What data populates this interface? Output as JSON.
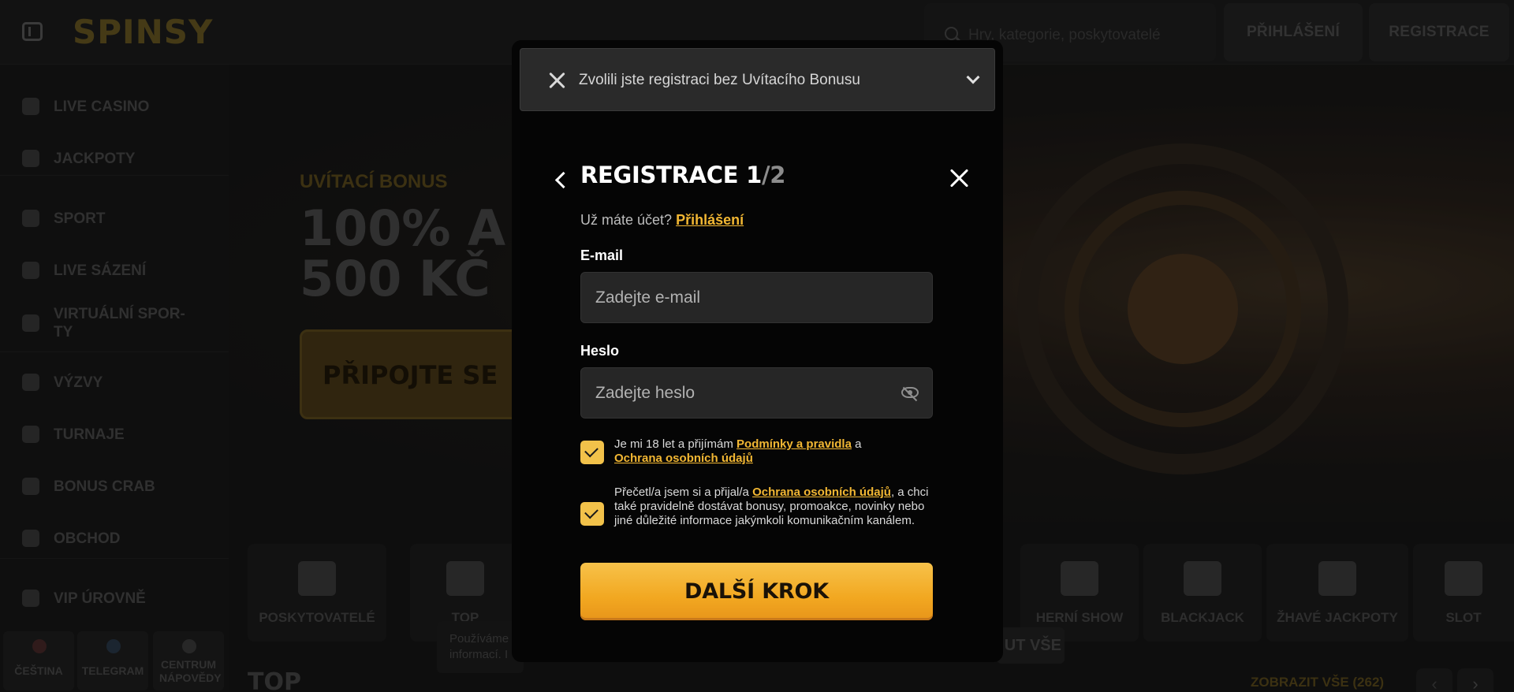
{
  "header": {
    "logo": "SPINSY",
    "search_placeholder": "Hry, kategorie, poskytovatelé",
    "login_label": "PŘIHLÁŠENÍ",
    "register_label": "REGISTRACE"
  },
  "sidebar": {
    "items": [
      {
        "label": "LIVE CASINO",
        "icon": "live-casino-icon"
      },
      {
        "label": "JACKPOTY",
        "icon": "clover-icon"
      },
      {
        "label": "SPORT",
        "icon": "sport-icon"
      },
      {
        "label": "LIVE SÁZENÍ",
        "icon": "live-betting-icon"
      },
      {
        "label": "VIRTUÁLNÍ SPOR-\nTY",
        "icon": "virtual-sports-icon"
      },
      {
        "label": "VÝZVY",
        "icon": "challenges-icon"
      },
      {
        "label": "TURNAJE",
        "icon": "trophy-icon"
      },
      {
        "label": "BONUS CRAB",
        "icon": "crab-icon"
      },
      {
        "label": "OBCHOD",
        "icon": "shop-icon"
      },
      {
        "label": "VIP ÚROVNĚ",
        "icon": "diamond-icon"
      }
    ],
    "footer": [
      {
        "label": "ČEŠTINA",
        "icon": "flag-icon"
      },
      {
        "label": "TELEGRAM",
        "icon": "telegram-icon"
      },
      {
        "label": "CENTRUM NÁPOVĚDY",
        "icon": "help-icon"
      }
    ]
  },
  "hero": {
    "subtitle": "UVÍTACÍ BONUS",
    "title_line1": "100% A",
    "title_line2": "500 KČ",
    "cta": "PŘIPOJTE SE"
  },
  "categories": [
    {
      "label": "POSKYTOVATELÉ",
      "icon": "book-icon"
    },
    {
      "label": "TOP",
      "icon": "crown-icon"
    },
    {
      "label": "HERNÍ SHOW",
      "icon": "wheel-icon"
    },
    {
      "label": "BLACKJACK",
      "icon": "card-icon"
    },
    {
      "label": "ŽHAVÉ JACKPOTY",
      "icon": "flame-icon"
    },
    {
      "label": "SLOT",
      "icon": "slot-icon"
    }
  ],
  "top_section": {
    "heading": "TOP",
    "show_all": "ZOBRAZIT VŠE (262)"
  },
  "cookie": {
    "text_line1": "Používáme",
    "text_line2": "informací. I",
    "button": "UT VŠE"
  },
  "modal": {
    "bonus_bar_text": "Zvolili jste registraci bez Uvítacího Bonusu",
    "title_main": "REGISTRACE 1",
    "title_suffix": "/2",
    "have_account": "Už máte účet?",
    "login_link": "Přihlášení",
    "email_label": "E-mail",
    "email_placeholder": "Zadejte e-mail",
    "password_label": "Heslo",
    "password_placeholder": "Zadejte heslo",
    "consent1_pre": "Je mi 18 let a přijímám ",
    "consent1_link1": "Podmínky a pravidla",
    "consent1_mid": " a ",
    "consent1_link2": "Ochrana osobních údajů",
    "consent2_pre": "Přečetl/a jsem si a přijal/a ",
    "consent2_link": "Ochrana osobních údajů",
    "consent2_post": ", a chci také pravidelně dostávat bonusy, promoakce, novinky nebo jiné důležité informace jakýmkoli komunikačním kanálem.",
    "consent1_checked": true,
    "consent2_checked": true,
    "next_button": "DALŠÍ KROK"
  },
  "colors": {
    "accent": "#f2b733",
    "button_gradient_top": "#f7c24a",
    "button_gradient_bottom": "#e8951a"
  }
}
